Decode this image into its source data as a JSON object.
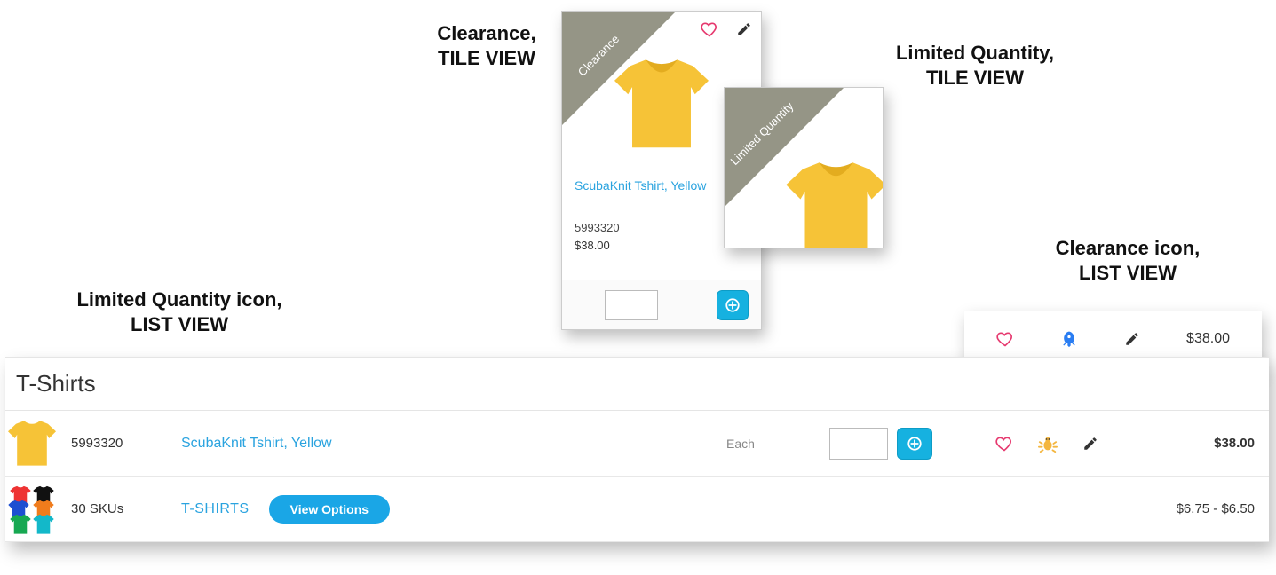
{
  "labels": {
    "clearance_tile": "Clearance,\nTILE VIEW",
    "limited_tile": "Limited Quantity,\nTILE VIEW",
    "limited_list": "Limited Quantity icon,\nLIST VIEW",
    "clearance_list": "Clearance icon,\nLIST VIEW"
  },
  "tile1": {
    "ribbon": "Clearance",
    "name": "ScubaKnit Tshirt, Yellow",
    "sku": "5993320",
    "price": "$38.00"
  },
  "tile2": {
    "ribbon": "Limited Quantity"
  },
  "callout": {
    "price": "$38.00"
  },
  "list": {
    "heading": "T-Shirts",
    "row1": {
      "sku": "5993320",
      "name": "ScubaKnit Tshirt, Yellow",
      "uom": "Each",
      "price": "$38.00"
    },
    "row2": {
      "sku": "30 SKUs",
      "name": "T-SHIRTS",
      "button": "View Options",
      "price": "$6.75 - $6.50"
    }
  },
  "colors": {
    "link": "#2aa3df",
    "accent": "#16b1e0",
    "ribbon": "#8f8f7f",
    "heart": "#e6396f",
    "rocket": "#2a7df2",
    "bug": "#f4b63f",
    "arrow": "#13b8c9"
  }
}
